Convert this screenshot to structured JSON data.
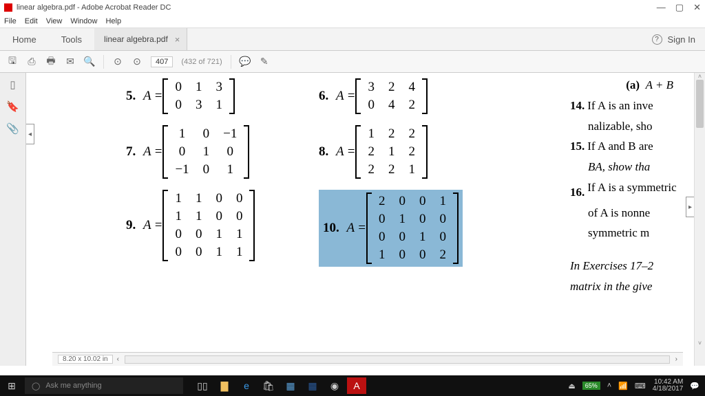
{
  "window": {
    "title": "linear algebra.pdf - Adobe Acrobat Reader DC",
    "min": "—",
    "max": "▢",
    "close": "✕"
  },
  "menu": {
    "file": "File",
    "edit": "Edit",
    "view": "View",
    "window": "Window",
    "help": "Help"
  },
  "tabs": {
    "home": "Home",
    "tools": "Tools",
    "doc": "linear algebra.pdf",
    "doc_close": "×",
    "signin": "Sign In"
  },
  "toolbar": {
    "page_num": "407",
    "page_total": "(432 of 721)"
  },
  "status": {
    "dims": "8.20 x 10.02 in"
  },
  "exercises": {
    "e5": {
      "num": "5.",
      "var": "A",
      "rows": [
        [
          "0",
          "1",
          "3"
        ],
        [
          "0",
          "3",
          "1"
        ]
      ]
    },
    "e6": {
      "num": "6.",
      "var": "A",
      "rows": [
        [
          "3",
          "2",
          "4"
        ],
        [
          "0",
          "4",
          "2"
        ]
      ]
    },
    "e7": {
      "num": "7.",
      "var": "A",
      "rows": [
        [
          "1",
          "0",
          "−1"
        ],
        [
          "0",
          "1",
          "0"
        ],
        [
          "−1",
          "0",
          "1"
        ]
      ]
    },
    "e8": {
      "num": "8.",
      "var": "A",
      "rows": [
        [
          "1",
          "2",
          "2"
        ],
        [
          "2",
          "1",
          "2"
        ],
        [
          "2",
          "2",
          "1"
        ]
      ]
    },
    "e9": {
      "num": "9.",
      "var": "A",
      "rows": [
        [
          "1",
          "1",
          "0",
          "0"
        ],
        [
          "1",
          "1",
          "0",
          "0"
        ],
        [
          "0",
          "0",
          "1",
          "1"
        ],
        [
          "0",
          "0",
          "1",
          "1"
        ]
      ]
    },
    "e10": {
      "num": "10.",
      "var": "A",
      "rows": [
        [
          "2",
          "0",
          "0",
          "1"
        ],
        [
          "0",
          "1",
          "0",
          "0"
        ],
        [
          "0",
          "0",
          "1",
          "0"
        ],
        [
          "1",
          "0",
          "0",
          "2"
        ]
      ]
    }
  },
  "right": {
    "a": "(a)",
    "a_expr": "A + B",
    "q14_num": "14.",
    "q14_text": "If A is an invertible, diagonalizable, sho",
    "q14_line1": "If A is an inve",
    "q14_line2": "nalizable, sho",
    "q15_num": "15.",
    "q15_line1": "If A and B are",
    "q15_line2": "BA, show tha",
    "q16_num": "16.",
    "q16_line1": "If A is a symmetric",
    "q16_line2": "of A is nonne",
    "q16_line3": "symmetric m",
    "instr1": "In Exercises 17–2",
    "instr2": "matrix in the give"
  },
  "taskbar": {
    "search_placeholder": "Ask me anything",
    "battery": "65%",
    "time": "10:42 AM",
    "date": "4/18/2017"
  },
  "chart_data": null
}
